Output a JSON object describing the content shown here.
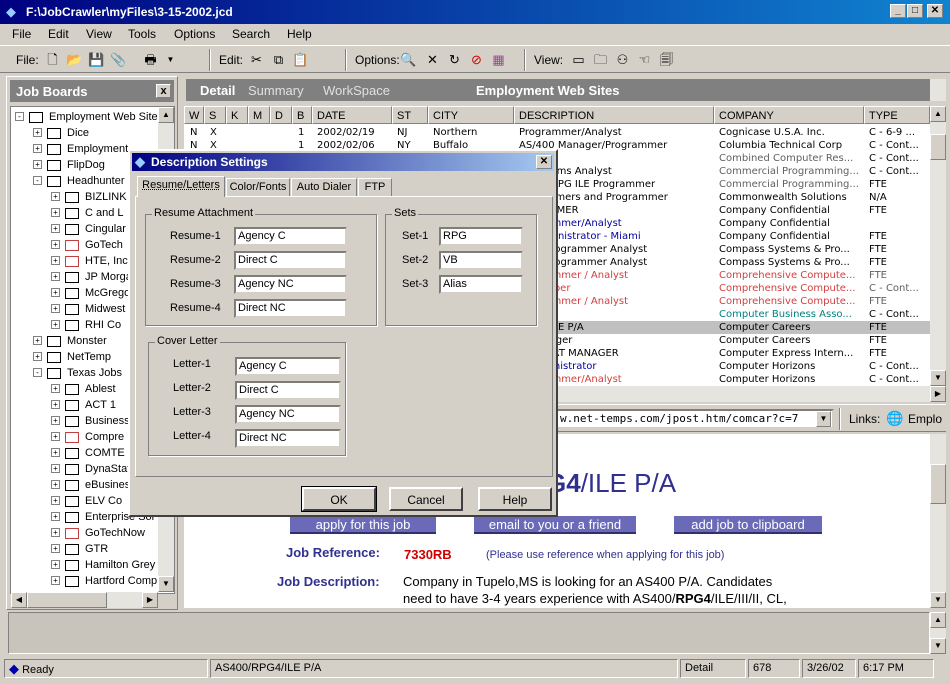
{
  "window": {
    "title": "F:\\JobCrawler\\myFiles\\3-15-2002.jcd"
  },
  "menu": [
    "File",
    "Edit",
    "View",
    "Tools",
    "Options",
    "Search",
    "Help"
  ],
  "toolbar": {
    "file_label": "File:",
    "edit_label": "Edit:",
    "options_label": "Options:",
    "view_label": "View:"
  },
  "left_panel": {
    "title": "Job Boards",
    "close": "x",
    "root": "Employment Web Sites",
    "items": [
      "Dice",
      "Employment",
      "FlipDog",
      "Headhunter",
      "BIZLINK",
      "C and L",
      "Cingular",
      "GoTech",
      "HTE, Inc",
      "JP Morgan",
      "McGregor",
      "Midwest",
      "RHI Co",
      "Monster",
      "NetTemp",
      "Texas Jobs",
      "Ablest",
      "ACT 1",
      "Business",
      "Compre",
      "COMTE",
      "DynaStaff",
      "eBusiness",
      "ELV Co",
      "Enterprise Sol",
      "GoTechNow",
      "GTR",
      "Hamilton Grey",
      "Hartford Comp"
    ]
  },
  "right_tabs": {
    "detail": "Detail",
    "summary": "Summary",
    "workspace": "WorkSpace",
    "title": "Employment Web Sites"
  },
  "grid": {
    "columns": [
      "W",
      "S",
      "K",
      "M",
      "D",
      "B",
      "DATE",
      "ST",
      "CITY",
      "DESCRIPTION",
      "COMPANY",
      "TYPE"
    ],
    "rows": [
      {
        "w": "N",
        "s": "X",
        "b": "1",
        "date": "2002/02/19",
        "st": "NJ",
        "city": "Northern",
        "desc": "Programmer/Analyst",
        "company": "Cognicase U.S.A. Inc.",
        "type": "C - 6-9 ..."
      },
      {
        "w": "N",
        "s": "X",
        "b": "1",
        "date": "2002/02/06",
        "st": "NY",
        "city": "Buffalo",
        "desc": "AS/400 Manager/Programmer",
        "company": "Columbia Technical Corp",
        "type": "C - Cont..."
      },
      {
        "desc": "rmer",
        "company": "Combined Computer Res...",
        "type": "C - Cont..."
      },
      {
        "desc": "B Systems Analyst",
        "company": "Commercial Programming...",
        "type": "C - Cont..."
      },
      {
        "desc": "S/400 RPG ILE Programmer",
        "company": "Commercial Programming...",
        "type": "FTE"
      },
      {
        "desc": "rogrammers and Programmer",
        "company": "Commonwealth Solutions",
        "type": "N/A"
      },
      {
        "desc": "OGRAMMER",
        "company": "Company Confidential",
        "type": "FTE"
      },
      {
        "desc": "Programmer/Analyst",
        "company": "Company Confidential",
        "type": ""
      },
      {
        "desc": "or Administrator - Miami",
        "company": "Company Confidential",
        "type": "FTE"
      },
      {
        "desc": "/400 Programmer Analyst",
        "company": "Compass Systems & Pro...",
        "type": "FTE"
      },
      {
        "desc": "/400 Programmer Analyst",
        "company": "Compass Systems & Pro...",
        "type": "FTE"
      },
      {
        "desc": "Programmer / Analyst",
        "company": "Comprehensive Compute...",
        "type": "FTE"
      },
      {
        "desc": "Developer",
        "company": "Comprehensive Compute...",
        "type": "C - Cont..."
      },
      {
        "desc": "Programmer / Analyst",
        "company": "Comprehensive Compute...",
        "type": "FTE"
      },
      {
        "desc": "n Lead",
        "company": "Computer Business Asso...",
        "type": "C - Cont..."
      },
      {
        "desc": "RPG4/ILE P/A",
        "company": "Computer Careers",
        "type": "FTE"
      },
      {
        "desc": "S Manager",
        "company": "Computer Careers",
        "type": "FTE"
      },
      {
        "desc": "SUPPORT MANAGER",
        "company": "Computer Express Intern...",
        "type": "FTE"
      },
      {
        "desc": "e Administrator",
        "company": "Computer Horizons",
        "type": "C - Cont..."
      },
      {
        "desc": "Programmer/Analyst",
        "company": "Computer Horizons",
        "type": "C - Cont..."
      }
    ]
  },
  "address": {
    "url": "w.net-temps.com/jpost.htm/comcar?c=7",
    "links_label": "Links:",
    "links_item": "Emplo"
  },
  "web": {
    "heading_bold": "G4",
    "heading_rest": "/ILE P/A",
    "apply": "apply for this job",
    "email": "email to you or a friend",
    "clipboard": "add job to clipboard",
    "ref_label": "Job Reference:",
    "ref_value": "7330RB",
    "ref_note": "(Please use reference when applying for this job)",
    "desc_label": "Job Description:",
    "desc_line1": "Company in Tupelo,MS is looking for an AS400 P/A. Candidates",
    "desc_line2a": "need to have 3-4 years experience with AS400/",
    "desc_line2b": "RPG4",
    "desc_line2c": "/ILE/III/II, CL,"
  },
  "dialog": {
    "title": "Description Settings",
    "tabs": [
      "Resume/Letters",
      "Color/Fonts",
      "Auto Dialer",
      "FTP"
    ],
    "resume_group": "Resume Attachment",
    "resumes": [
      {
        "label": "Resume-1",
        "value": "Agency C"
      },
      {
        "label": "Resume-2",
        "value": "Direct C"
      },
      {
        "label": "Resume-3",
        "value": "Agency NC"
      },
      {
        "label": "Resume-4",
        "value": "Direct NC"
      }
    ],
    "sets_group": "Sets",
    "sets": [
      {
        "label": "Set-1",
        "value": "RPG"
      },
      {
        "label": "Set-2",
        "value": "VB"
      },
      {
        "label": "Set-3",
        "value": "Alias"
      }
    ],
    "cover_group": "Cover Letter",
    "letters": [
      {
        "label": "Letter-1",
        "value": "Agency C"
      },
      {
        "label": "Letter-2",
        "value": "Direct C"
      },
      {
        "label": "Letter-3",
        "value": "Agency NC"
      },
      {
        "label": "Letter-4",
        "value": "Direct NC"
      }
    ],
    "ok": "OK",
    "cancel": "Cancel",
    "help": "Help"
  },
  "status": {
    "ready": "Ready",
    "desc": "AS400/RPG4/ILE P/A",
    "view": "Detail",
    "count": "678",
    "date": "3/26/02",
    "time": "6:17 PM"
  }
}
